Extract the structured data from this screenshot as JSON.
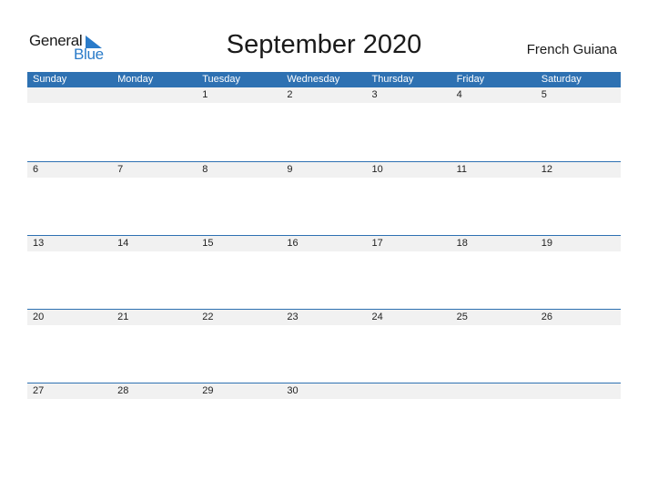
{
  "logo": {
    "line1": "General",
    "line2": "Blue"
  },
  "title": "September 2020",
  "country": "French Guiana",
  "colors": {
    "accent": "#2e71b2",
    "date_strip": "#f1f1f1",
    "logo_blue": "#2a7bc9"
  },
  "weekdays": [
    "Sunday",
    "Monday",
    "Tuesday",
    "Wednesday",
    "Thursday",
    "Friday",
    "Saturday"
  ],
  "weeks": [
    [
      "",
      "",
      "1",
      "2",
      "3",
      "4",
      "5"
    ],
    [
      "6",
      "7",
      "8",
      "9",
      "10",
      "11",
      "12"
    ],
    [
      "13",
      "14",
      "15",
      "16",
      "17",
      "18",
      "19"
    ],
    [
      "20",
      "21",
      "22",
      "23",
      "24",
      "25",
      "26"
    ],
    [
      "27",
      "28",
      "29",
      "30",
      "",
      "",
      ""
    ]
  ]
}
